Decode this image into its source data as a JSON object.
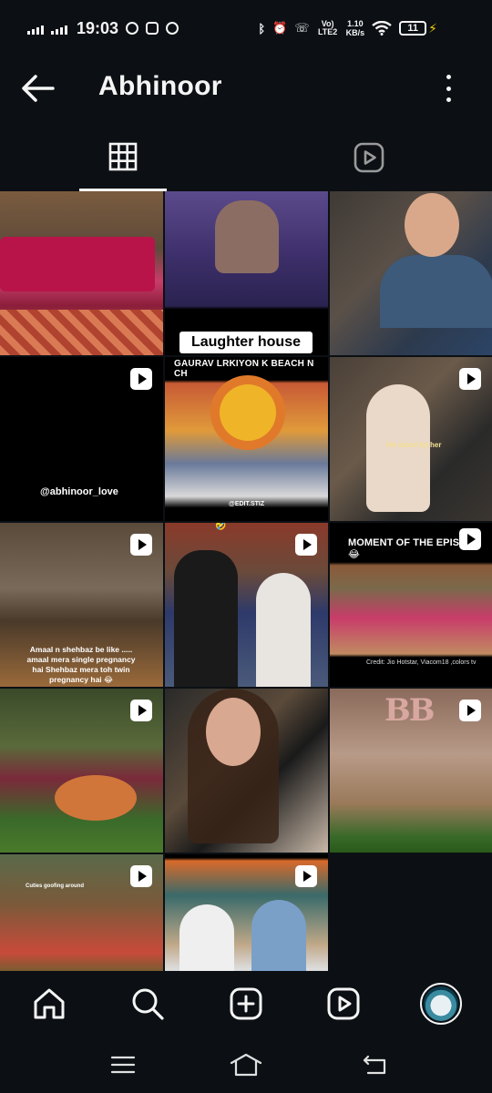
{
  "status_bar": {
    "time": "19:03",
    "network": "Vo) LTE2",
    "speed_value": "1.10",
    "speed_unit": "KB/s",
    "battery": "11"
  },
  "header": {
    "title": "Abhinoor"
  },
  "tabs": [
    {
      "name": "grid",
      "icon": "grid-icon",
      "active": true
    },
    {
      "name": "reels",
      "icon": "reels-icon",
      "active": false
    }
  ],
  "grid": {
    "tiles": [
      {
        "type": "post",
        "caption": ""
      },
      {
        "type": "post",
        "caption": "Laughter house"
      },
      {
        "type": "post",
        "caption": ""
      },
      {
        "type": "reel",
        "caption": "@abhinoor_love"
      },
      {
        "type": "post",
        "caption": "GAURAV LRKIYON K BEACH N CH",
        "caption2": "@EDIT.STIZ"
      },
      {
        "type": "reel",
        "caption": "He stood by her"
      },
      {
        "type": "reel",
        "caption": "Amaal n shehbaz be like ..... amaal mera single pregnancy hai Shehbaz mera toh twin pregnancy hai 😂"
      },
      {
        "type": "reel",
        "caption": "🤣"
      },
      {
        "type": "reel",
        "caption": "MOMENT OF THE EPISODE 😂",
        "caption2": "Credit: Jio Hotstar, Viacom18 ,colors tv"
      },
      {
        "type": "reel",
        "caption": ""
      },
      {
        "type": "post",
        "caption": ""
      },
      {
        "type": "reel",
        "caption": "BB"
      },
      {
        "type": "reel",
        "caption": "Cuties goofing around"
      },
      {
        "type": "reel",
        "caption": ""
      }
    ]
  },
  "bottom_nav": {
    "items": [
      "home-icon",
      "search-icon",
      "create-icon",
      "reels-icon",
      "profile-avatar"
    ]
  },
  "colors": {
    "background": "#0c1014",
    "foreground": "#f5f5f5",
    "charging": "#f5d000"
  }
}
